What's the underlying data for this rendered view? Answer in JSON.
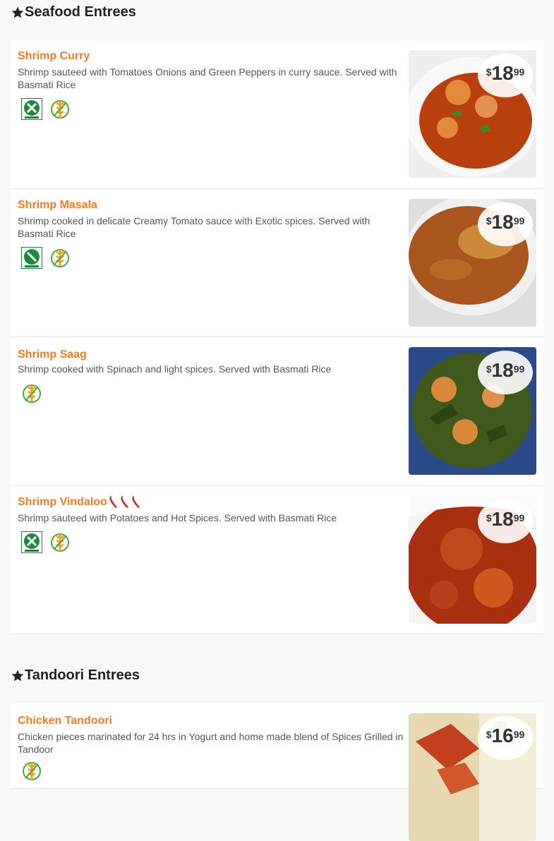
{
  "sections": [
    {
      "title": "Seafood Entrees"
    },
    {
      "title": "Tandoori Entrees"
    }
  ],
  "items": [
    {
      "name": "Shrimp Curry",
      "description": "Shrimp sauteed with Tomatoes Onions and Green Peppers in curry sauce. Served with Basmati Rice",
      "price_currency": "$",
      "price_dollars": "18",
      "price_cents": "99",
      "badges": [
        "dairy-free-icon",
        "gluten-free-icon"
      ],
      "photo_colors": [
        "#b8400e",
        "#e08a3a"
      ]
    },
    {
      "name": "Shrimp Masala",
      "description": "Shrimp cooked in delicate Creamy Tomato sauce with Exotic spices. Served with Basmati Rice",
      "price_currency": "$",
      "price_dollars": "18",
      "price_cents": "99",
      "badges": [
        "dairy-icon",
        "gluten-free-icon"
      ],
      "photo_colors": [
        "#a8561e",
        "#c98a3a"
      ]
    },
    {
      "name": "Shrimp Saag",
      "description": "Shrimp cooked with Spinach and light spices. Served with Basmati Rice",
      "price_currency": "$",
      "price_dollars": "18",
      "price_cents": "99",
      "badges": [
        "gluten-free-icon"
      ],
      "photo_colors": [
        "#3f5a1c",
        "#d88a3a"
      ]
    },
    {
      "name": "Shrimp Vindaloo",
      "description": "Shrimp sauteed with Potatoes and Hot Spices. Served with Basmati Rice",
      "price_currency": "$",
      "price_dollars": "18",
      "price_cents": "99",
      "badges": [
        "dairy-free-icon",
        "gluten-free-icon"
      ],
      "spice_level": 3,
      "photo_colors": [
        "#a8300e",
        "#d0581e"
      ]
    },
    {
      "name": "Chicken Tandoori",
      "description": "Chicken pieces marinated for 24 hrs in Yogurt and home made blend of Spices Grilled in Tandoor",
      "price_currency": "$",
      "price_dollars": "16",
      "price_cents": "99",
      "badges": [
        "gluten-free-icon"
      ],
      "photo_colors": [
        "#c2401e",
        "#e8d8b0"
      ]
    }
  ],
  "colors": {
    "accent": "#f47b20",
    "badge_green": "#1a8a3a"
  }
}
